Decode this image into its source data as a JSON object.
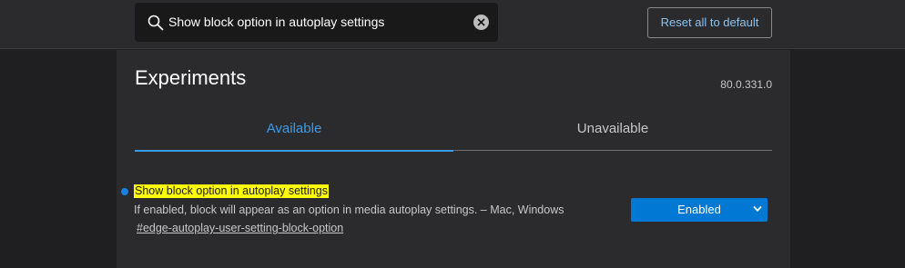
{
  "search": {
    "value": "Show block option in autoplay settings",
    "icon": "search-icon",
    "clear_icon": "close-icon"
  },
  "header": {
    "reset_label": "Reset all to default"
  },
  "main": {
    "title": "Experiments",
    "version": "80.0.331.0",
    "tabs": [
      {
        "label": "Available",
        "active": true
      },
      {
        "label": "Unavailable",
        "active": false
      }
    ]
  },
  "flag": {
    "title": "Show block option in autoplay settings",
    "description": "If enabled, block will appear as an option in media autoplay settings. – Mac, Windows",
    "link": "#edge-autoplay-user-setting-block-option",
    "selected_value": "Enabled"
  },
  "colors": {
    "accent": "#3b9be8",
    "select_bg": "#0078d4",
    "highlight": "#ffff00"
  }
}
